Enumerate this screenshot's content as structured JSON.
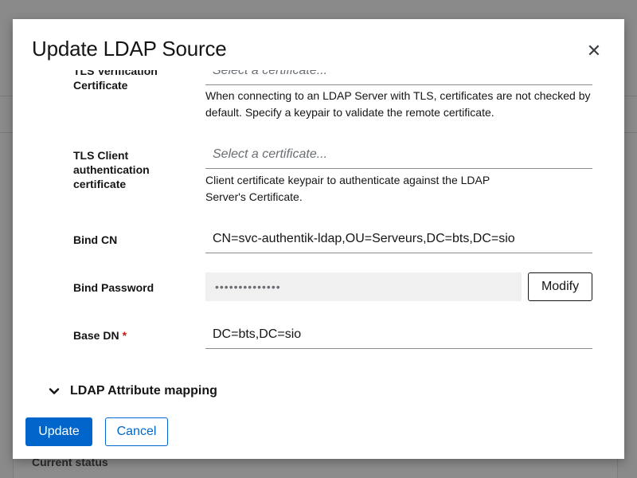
{
  "background": {
    "status_heading": "Current status"
  },
  "modal": {
    "title": "Update LDAP Source",
    "close_icon": "close-icon"
  },
  "form": {
    "tls_verification": {
      "label": "TLS Verification Certificate",
      "placeholder": "Select a certificate...",
      "help": "When connecting to an LDAP Server with TLS, certificates are not checked by default. Specify a keypair to validate the remote certificate."
    },
    "tls_client": {
      "label": "TLS Client authentication certificate",
      "placeholder": "Select a certificate...",
      "help": "Client certificate keypair to authenticate against the LDAP Server's Certificate."
    },
    "bind_cn": {
      "label": "Bind CN",
      "value": "CN=svc-authentik-ldap,OU=Serveurs,DC=bts,DC=sio"
    },
    "bind_password": {
      "label": "Bind Password",
      "masked": "••••••••••••••",
      "modify_label": "Modify"
    },
    "base_dn": {
      "label": "Base DN",
      "required_mark": "*",
      "value": "DC=bts,DC=sio"
    },
    "attribute_mapping": {
      "label": "LDAP Attribute mapping",
      "icon": "chevron-down-icon"
    }
  },
  "footer": {
    "update_label": "Update",
    "cancel_label": "Cancel"
  },
  "colors": {
    "primary": "#0066cc",
    "required": "#c9190b"
  }
}
